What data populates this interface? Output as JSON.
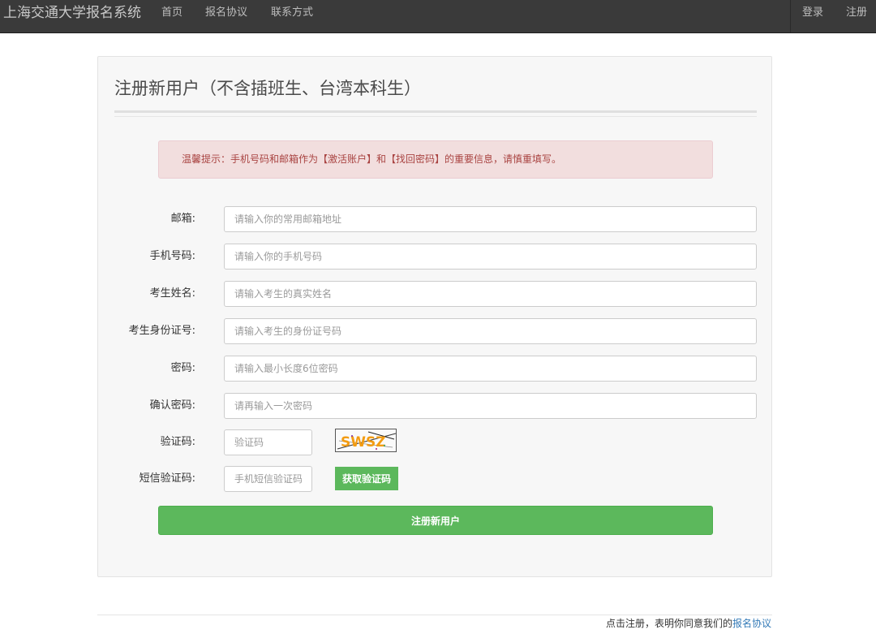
{
  "navbar": {
    "brand": "上海交通大学报名系统",
    "links": [
      "首页",
      "报名协议",
      "联系方式"
    ],
    "right_links": [
      "登录",
      "注册"
    ]
  },
  "panel": {
    "title": "注册新用户（不含插班生、台湾本科生）",
    "alert": "温馨提示：手机号码和邮箱作为【激活账户】和【找回密码】的重要信息，请慎重填写。"
  },
  "form": {
    "fields": [
      {
        "label": "邮箱:",
        "placeholder": "请输入你的常用邮箱地址",
        "value": ""
      },
      {
        "label": "手机号码:",
        "placeholder": "请输入你的手机号码",
        "value": ""
      },
      {
        "label": "考生姓名:",
        "placeholder": "请输入考生的真实姓名",
        "value": ""
      },
      {
        "label": "考生身份证号:",
        "placeholder": "请输入考生的身份证号码",
        "value": ""
      },
      {
        "label": "密码:",
        "placeholder": "请输入最小长度6位密码",
        "value": ""
      },
      {
        "label": "确认密码:",
        "placeholder": "请再输入一次密码",
        "value": ""
      }
    ],
    "captcha": {
      "label": "验证码:",
      "placeholder": "验证码",
      "image_text": "SWSZ"
    },
    "sms": {
      "label": "短信验证码:",
      "placeholder": "手机短信验证码",
      "button": "获取验证码"
    },
    "submit": "注册新用户"
  },
  "footer": {
    "text": "点击注册，表明你同意我们的",
    "link": "报名协议"
  },
  "colors": {
    "navbar": "#3a3a3a",
    "success": "#5cb85c",
    "alert_bg": "#f2dede",
    "alert_text": "#a94442",
    "link": "#337ab7"
  }
}
